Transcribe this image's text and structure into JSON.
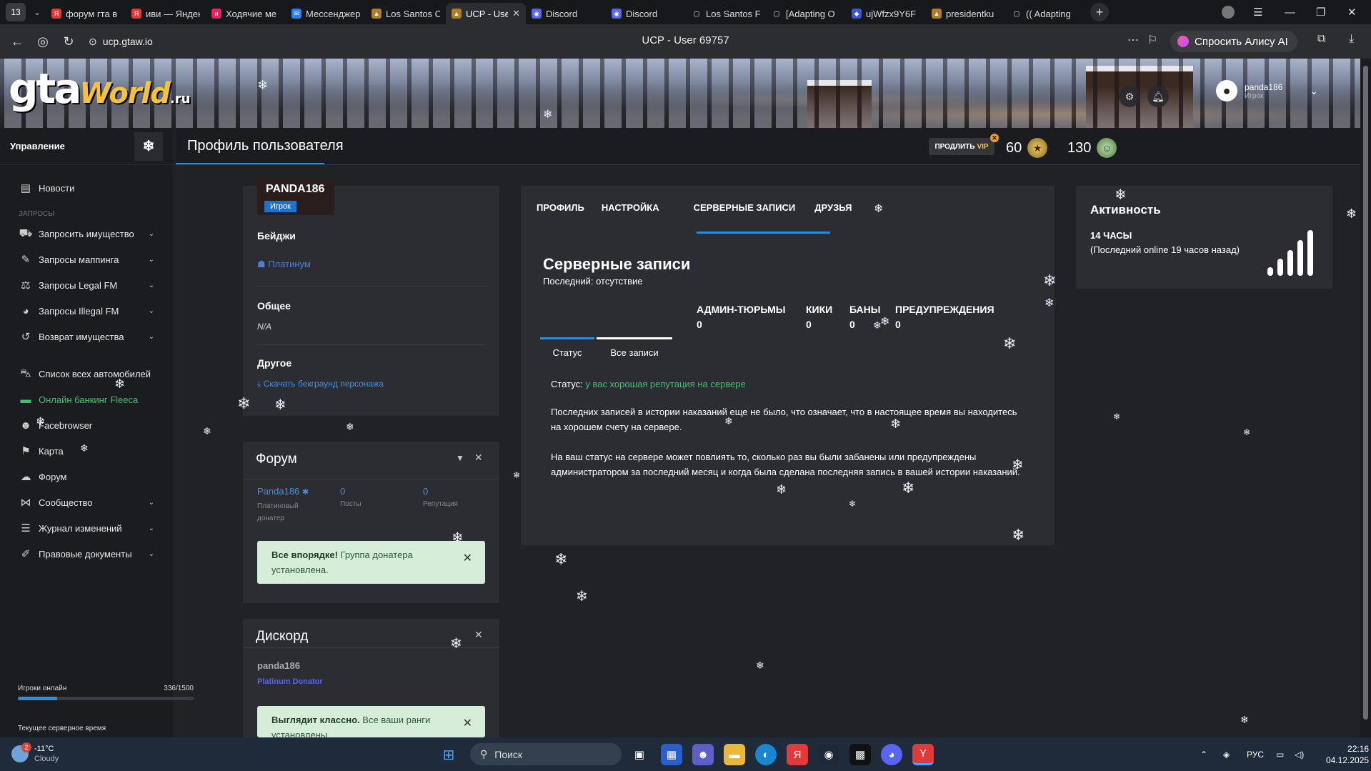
{
  "browser": {
    "tab_count": "13",
    "tabs": [
      {
        "label": "форум гта в",
        "fav": "Я",
        "color": "#e03a3a"
      },
      {
        "label": "иви — Яндекс",
        "fav": "Я",
        "color": "#e03a3a"
      },
      {
        "label": "Ходячие ме",
        "fav": "и",
        "color": "#e0245e"
      },
      {
        "label": "Мессенджер",
        "fav": "✉",
        "color": "#2a7fff"
      },
      {
        "label": "Los Santos C",
        "fav": "▲",
        "color": "#b07d2a"
      },
      {
        "label": "UCP - User",
        "fav": "▲",
        "color": "#b07d2a"
      },
      {
        "label": "Discord",
        "fav": "◉",
        "color": "#5865f2"
      },
      {
        "label": "Discord",
        "fav": "◉",
        "color": "#5865f2"
      },
      {
        "label": "Los Santos F",
        "fav": "▢",
        "color": "transparent"
      },
      {
        "label": "[Adapting O",
        "fav": "▢",
        "color": "transparent"
      },
      {
        "label": "ujWfzx9Y6F",
        "fav": "◆",
        "color": "#3a55d6"
      },
      {
        "label": "presidentku",
        "fav": "▲",
        "color": "#b07d2a"
      },
      {
        "label": "(( Adapting",
        "fav": "▢",
        "color": "transparent"
      }
    ],
    "url": "ucp.gtaw.io",
    "page_title": "UCP - User 69757",
    "alice_label": "Спросить Алису AI"
  },
  "header": {
    "logo_gta": "gta",
    "logo_world": "World",
    "logo_ru": ".ru",
    "username": "panda186",
    "role": "Игрок"
  },
  "sidebar": {
    "title": "Управление",
    "items": [
      {
        "label": "Новости",
        "icon": "▤",
        "name": "news",
        "chevron": false,
        "section": ""
      },
      {
        "label": "Запросить имущество",
        "icon": "⛟",
        "name": "request-property",
        "chevron": true,
        "section": "ЗАПРОСЫ"
      },
      {
        "label": "Запросы маппинга",
        "icon": "✎",
        "name": "mapping-requests",
        "chevron": true,
        "section": ""
      },
      {
        "label": "Запросы Legal FM",
        "icon": "⚖",
        "name": "legal-fm-requests",
        "chevron": true,
        "section": ""
      },
      {
        "label": "Запросы Illegal FM",
        "icon": "◕",
        "name": "illegal-fm-requests",
        "chevron": true,
        "section": ""
      },
      {
        "label": "Возврат имущества",
        "icon": "↺",
        "name": "property-return",
        "chevron": true,
        "section": ""
      },
      {
        "label": "Список всех автомобилей",
        "icon": "⛍",
        "name": "all-vehicles",
        "chevron": false,
        "section": ""
      },
      {
        "label": "Онлайн банкинг Fleeca",
        "icon": "▬",
        "name": "fleeca-banking",
        "chevron": false,
        "section": ""
      },
      {
        "label": "Facebrowser",
        "icon": "☻",
        "name": "facebrowser",
        "chevron": false,
        "section": ""
      },
      {
        "label": "Карта",
        "icon": "⚑",
        "name": "map",
        "chevron": false,
        "section": ""
      },
      {
        "label": "Форум",
        "icon": "☁",
        "name": "forum",
        "chevron": false,
        "section": ""
      },
      {
        "label": "Сообщество",
        "icon": "⋈",
        "name": "community",
        "chevron": true,
        "section": ""
      },
      {
        "label": "Журнал изменений",
        "icon": "☰",
        "name": "changelog",
        "chevron": true,
        "section": ""
      },
      {
        "label": "Правовые документы",
        "icon": "✐",
        "name": "legal-docs",
        "chevron": true,
        "section": ""
      }
    ],
    "online_label": "Игроки онлайн",
    "online_value": "336/1500",
    "online_fraction": 0.224,
    "server_time_label": "Текущее серверное время"
  },
  "titlebar": {
    "title": "Профиль пользователя",
    "vip_prefix": "ПРОДЛИТЬ",
    "vip_word": "VIP",
    "coins_gold": "60",
    "coins_green": "130"
  },
  "profile": {
    "name": "PANDA186",
    "role_badge": "Игрок",
    "badges_label": "Бейджи",
    "badge_value": "Платинум",
    "general_label": "Общее",
    "general_value": "N/A",
    "other_label": "Другое",
    "download_link": "Скачать бекграунд персонажа"
  },
  "forum": {
    "title": "Форум",
    "user": "Panda186",
    "user_group": "Платиновый донатер",
    "posts_value": "0",
    "posts_label": "Посты",
    "rep_value": "0",
    "rep_label": "Репутация",
    "alert_bold": "Все впорядке!",
    "alert_text": "Группа донатера установлена."
  },
  "discord": {
    "title": "Дискорд",
    "user": "panda186",
    "role": "Platinum Donator",
    "alert_bold": "Выглядит классно.",
    "alert_text": "Все ваши ранги установлены"
  },
  "main": {
    "tabs": [
      "ПРОФИЛЬ",
      "НАСТРОЙКА",
      "СЕРВЕРНЫЕ ЗАПИСИ",
      "ДРУЗЬЯ"
    ],
    "heading": "Серверные записи",
    "last": "Последний: отсутствие",
    "stats": [
      {
        "label": "АДМИН-ТЮРЬМЫ",
        "value": "0"
      },
      {
        "label": "КИКИ",
        "value": "0"
      },
      {
        "label": "БАНЫ",
        "value": "0"
      },
      {
        "label": "ПРЕДУПРЕЖДЕНИЯ",
        "value": "0"
      }
    ],
    "subtabs": [
      "Статус",
      "Все записи"
    ],
    "status_label": "Статус:",
    "status_value": "у вас хорошая репутация на сервере",
    "para1": "Последних записей в истории наказаний еще не было, что означает, что в настоящее время вы находитесь на хорошем счету на сервере.",
    "para2": "На ваш статус на сервере может повлиять то, сколько раз вы были забанены или предупреждены администратором за последний месяц и когда была сделана последняя запись в вашей истории наказаний."
  },
  "activity": {
    "title": "Активность",
    "hours": "14 ЧАСЫ",
    "last_online": "(Последний online 19 часов назад)"
  },
  "taskbar": {
    "badge": "2",
    "temp": "-11°C",
    "weather": "Cloudy",
    "search": "Поиск",
    "lang": "РУС",
    "time": "22:16",
    "date": "04.12.2025"
  }
}
